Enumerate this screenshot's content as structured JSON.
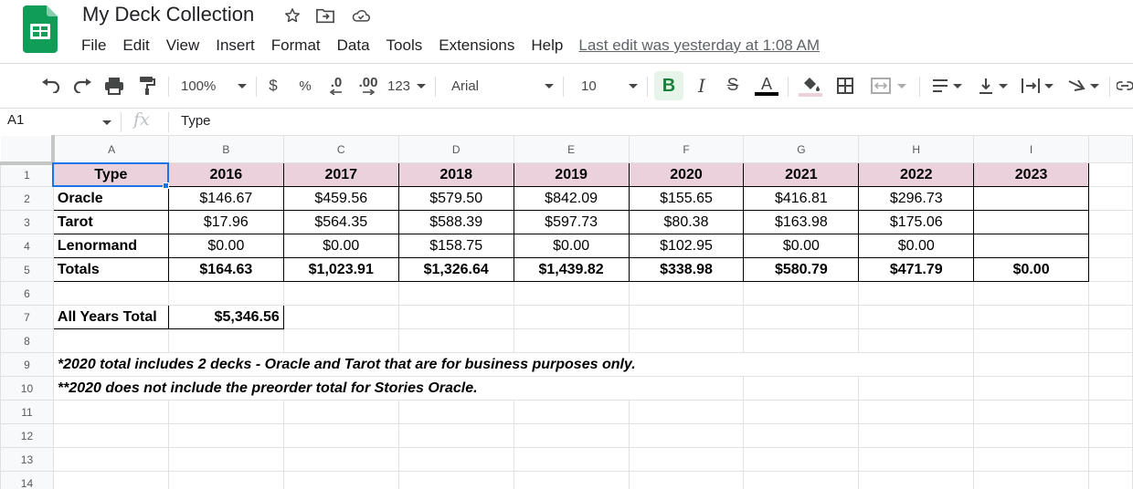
{
  "app": {
    "doc_title": "My Deck Collection",
    "menus": [
      "File",
      "Edit",
      "View",
      "Insert",
      "Format",
      "Data",
      "Tools",
      "Extensions",
      "Help"
    ],
    "last_edit": "Last edit was yesterday at 1:08 AM",
    "brand_color": "#0f9d58"
  },
  "toolbar": {
    "zoom": "100%",
    "currency": "$",
    "percent": "%",
    "decrease_decimal": ".0",
    "increase_decimal": ".00",
    "more_formats": "123",
    "font": "Arial",
    "font_size": "10",
    "bold": "B",
    "italic": "I",
    "strikethrough": "S",
    "text_color": "A",
    "bold_active": true
  },
  "formula_bar": {
    "cell_ref": "A1",
    "fx": "fx",
    "value": "Type"
  },
  "grid": {
    "columns": [
      "A",
      "B",
      "C",
      "D",
      "E",
      "F",
      "G",
      "H",
      "I"
    ],
    "rows": [
      "1",
      "2",
      "3",
      "4",
      "5",
      "6",
      "7",
      "8",
      "9",
      "10",
      "11",
      "12",
      "13",
      "14"
    ],
    "header_fill": "#ead1dc",
    "header_row": [
      "Type",
      "2016",
      "2017",
      "2018",
      "2019",
      "2020",
      "2021",
      "2022",
      "2023"
    ],
    "data_rows": [
      [
        "Oracle",
        "$146.67",
        "$459.56",
        "$579.50",
        "$842.09",
        "$155.65",
        "$416.81",
        "$296.73",
        ""
      ],
      [
        "Tarot",
        "$17.96",
        "$564.35",
        "$588.39",
        "$597.73",
        "$80.38",
        "$163.98",
        "$175.06",
        ""
      ],
      [
        "Lenormand",
        "$0.00",
        "$0.00",
        "$158.75",
        "$0.00",
        "$102.95",
        "$0.00",
        "$0.00",
        ""
      ],
      [
        "Totals",
        "$164.63",
        "$1,023.91",
        "$1,326.64",
        "$1,439.82",
        "$338.98",
        "$580.79",
        "$471.79",
        "$0.00"
      ]
    ],
    "all_years_label": "All Years Total",
    "all_years_value": "$5,346.56",
    "note_1": "*2020 total includes 2 decks - Oracle and Tarot that are for business purposes only.",
    "note_2": "**2020 does not include the preorder total for Stories Oracle."
  }
}
